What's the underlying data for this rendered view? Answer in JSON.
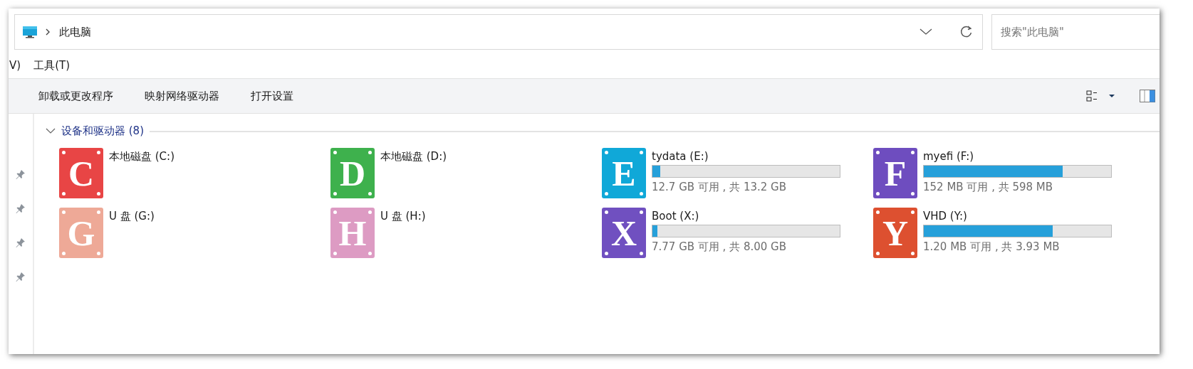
{
  "address_bar": {
    "location": "此电脑"
  },
  "search": {
    "placeholder": "搜索\"此电脑\""
  },
  "menu": [
    "V)",
    "工具(T)"
  ],
  "toolbar": {
    "buttons": [
      "卸载或更改程序",
      "映射网络驱动器",
      "打开设置"
    ]
  },
  "group": {
    "title": "设备和驱动器 (8)",
    "expanded": true
  },
  "drives": [
    {
      "kind": "plain",
      "letter": "C",
      "color": "#e84545",
      "name": "本地磁盘 (C:)"
    },
    {
      "kind": "plain",
      "letter": "D",
      "color": "#3eb14d",
      "name": "本地磁盘 (D:)"
    },
    {
      "kind": "meter",
      "letter": "E",
      "color": "#10a8d8",
      "name": "tydata (E:)",
      "level": 0.04,
      "space": "12.7 GB 可用 , 共 13.2 GB"
    },
    {
      "kind": "meter",
      "letter": "F",
      "color": "#6e4dbf",
      "name": "myefi (F:)",
      "level": 0.74,
      "space": "152 MB 可用 , 共 598 MB"
    },
    {
      "kind": "plain",
      "letter": "G",
      "color": "#eea997",
      "name": "U 盘 (G:)"
    },
    {
      "kind": "plain",
      "letter": "H",
      "color": "#dd9bc3",
      "name": "U 盘 (H:)"
    },
    {
      "kind": "meter",
      "letter": "X",
      "color": "#7050c0",
      "name": "Boot (X:)",
      "level": 0.025,
      "space": "7.77 GB 可用 , 共 8.00 GB"
    },
    {
      "kind": "meter",
      "letter": "Y",
      "color": "#dd5030",
      "name": "VHD (Y:)",
      "level": 0.69,
      "space": "1.20 MB 可用 , 共 3.93 MB"
    }
  ]
}
